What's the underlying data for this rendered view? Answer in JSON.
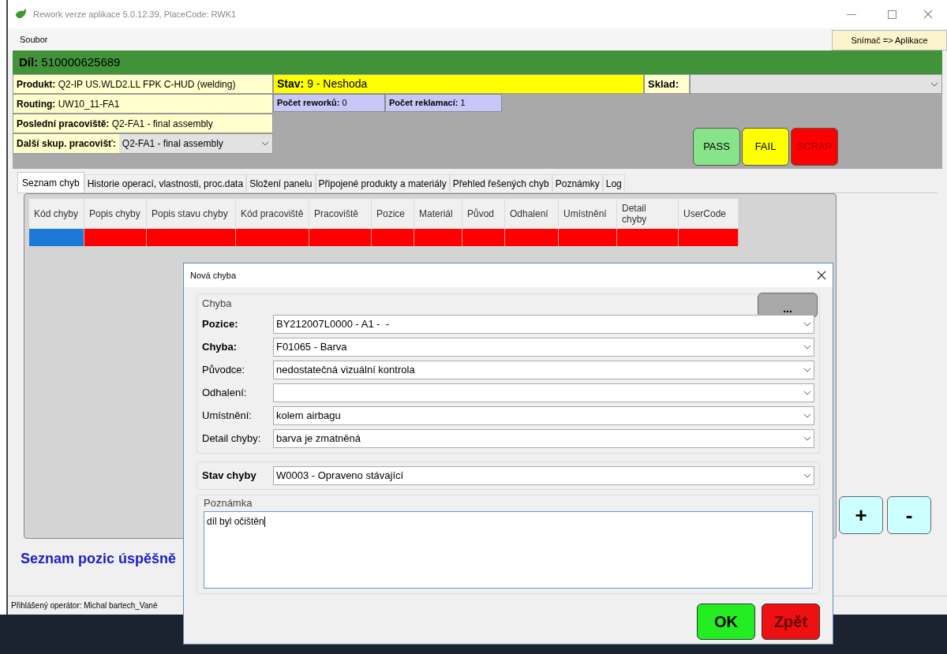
{
  "window": {
    "title": "Rework verze aplikace 5.0.12.39, PlaceCode: RWK1"
  },
  "menu": [
    "Soubor"
  ],
  "scanner_button": "Snímač => Aplikace",
  "part": {
    "label": "Díl:",
    "value": "510000625689"
  },
  "info": {
    "product": {
      "label": "Produkt:",
      "value": "Q2-IP US.WLD2.LL FPK C-HUD (welding)"
    },
    "routing": {
      "label": "Routing:",
      "value": "UW10_11-FA1"
    },
    "last_workplace": {
      "label": "Poslední pracoviště:",
      "value": "Q2-FA1 - final assembly"
    },
    "next_group": {
      "label": "Další skup. pracovišť:",
      "value": "Q2-FA1 - final assembly"
    },
    "status": {
      "label": "Stav:",
      "value": "9 - Neshoda"
    },
    "rework_count": {
      "label": "Počet reworků:",
      "value": "0"
    },
    "complaint_count": {
      "label": "Počet reklamací:",
      "value": "1"
    },
    "warehouse": {
      "label": "Sklad:"
    }
  },
  "action_buttons": [
    {
      "label": "PASS",
      "kind": "pass"
    },
    {
      "label": "FAIL",
      "kind": "fail"
    },
    {
      "label": "SCRAP",
      "kind": "scrap"
    }
  ],
  "tabs": [
    {
      "label": "Seznam chyb",
      "selected": true
    },
    {
      "label": "Historie operací, vlastnosti, proc.data",
      "selected": false
    },
    {
      "label": "Složení panelu",
      "selected": false
    },
    {
      "label": "Připojené produkty a materiály",
      "selected": false
    },
    {
      "label": "Přehled řešených chyb",
      "selected": false
    },
    {
      "label": "Poznámky",
      "selected": false
    },
    {
      "label": "Log",
      "selected": false
    }
  ],
  "table": {
    "columns": [
      "Kód chyby",
      "Popis chyby",
      "Popis stavu chyby",
      "Kód pracoviště",
      "Pracoviště",
      "Pozice",
      "Materiál",
      "Původ",
      "Odhalení",
      "Umístnění",
      "Detail chyby",
      "UserCode"
    ],
    "rows": [
      {
        "selected": true,
        "color": "#ff0000"
      }
    ]
  },
  "side_buttons": [
    "+",
    "-"
  ],
  "success_heading": "Seznam pozic úspěšně",
  "status_bar": "Přihlášený operátor: Michal bartech_Vané",
  "dialog": {
    "title": "Nová chyba",
    "group": "Chyba",
    "more_button": "...",
    "fields": [
      {
        "label": "Pozice:",
        "value": "BY212007L0000 - A1 -  -",
        "bold": true
      },
      {
        "label": "Chyba:",
        "value": "F01065 - Barva",
        "bold": true
      },
      {
        "label": "Původce:",
        "value": "nedostatečná vizuální kontrola",
        "bold": false
      },
      {
        "label": "Odhalení:",
        "bold": false
      },
      {
        "label": "Umístnění:",
        "value": "kolem airbagu",
        "bold": false
      },
      {
        "label": "Detail chyby:",
        "value": "barva je zmatněná",
        "bold": false
      }
    ],
    "status_field": {
      "label": "Stav chyby",
      "value": "W0003 - Opraveno stávající"
    },
    "note": {
      "label": "Poznámka",
      "value": "díl byl očištěn"
    },
    "ok_button": "OK",
    "back_button": "Zpět"
  }
}
